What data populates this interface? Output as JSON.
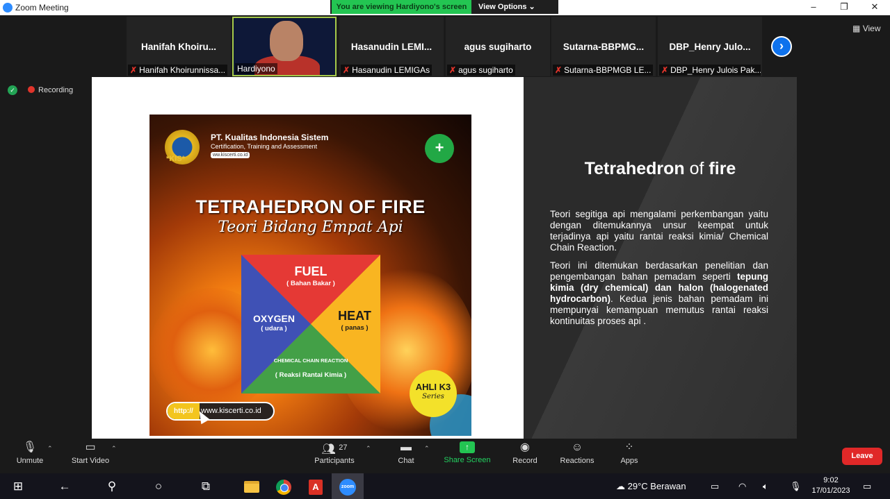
{
  "window": {
    "title": "Zoom Meeting",
    "minimize_icon": "minimize-icon",
    "restore_icon": "restore-icon",
    "close_icon": "close-icon"
  },
  "share_banner": {
    "viewing_text": "You are viewing Hardiyono's screen",
    "view_options_label": "View Options"
  },
  "participants": [
    {
      "tile_name": "Hanifah  Khoiru...",
      "label": "Hanifah Khoirunnissa...",
      "muted": true,
      "video": false
    },
    {
      "tile_name": "",
      "label": "Hardiyono",
      "muted": false,
      "video": true
    },
    {
      "tile_name": "Hasanudin  LEMI...",
      "label": "Hasanudin LEMIGAs",
      "muted": true,
      "video": false
    },
    {
      "tile_name": "agus sugiharto",
      "label": "agus sugiharto",
      "muted": true,
      "video": false
    },
    {
      "tile_name": "Sutarna-BBPMG...",
      "label": "Sutarna-BBPMGB LE...",
      "muted": true,
      "video": false
    },
    {
      "tile_name": "DBP_Henry  Julo...",
      "label": "DBP_Henry Julois Pak...",
      "muted": true,
      "video": false
    }
  ],
  "view_label": "View",
  "recording_label": "Recording",
  "poster": {
    "company": "PT. Kualitas Indonesia Sistem",
    "company_sub": "Certification, Training and Assessment",
    "company_url": "ww.kiscerti.co.id",
    "logo_text": "*KIS*",
    "title": "TETRAHEDRON OF FIRE",
    "subtitle": "Teori Bidang Empat Api",
    "fuel": "FUEL",
    "fuel_sub": "( Bahan Bakar )",
    "heat": "HEAT",
    "heat_sub": "( panas )",
    "oxygen": "OXYGEN",
    "oxygen_sub": "( udara )",
    "chemical": "CHEMICAL CHAIN REACTION",
    "chemical_sub": "( Reaksi Rantai Kimia )",
    "badge": "AHLI K3",
    "badge_sub": "Series",
    "url_prefix": "http://",
    "url": "www.kiscerti.co.id"
  },
  "slide": {
    "title_bold1": "Tetrahedron",
    "title_mid": " of ",
    "title_bold2": "fire",
    "para1": "Teori segitiga api mengalami perkembangan yaitu dengan ditemukannya unsur keempat untuk terjadinya api yaitu rantai reaksi kimia/ Chemical Chain Reaction.",
    "para2_a": "Teori ini ditemukan berdasarkan penelitian dan pengembangan bahan pemadam seperti ",
    "para2_b": "tepung kimia (dry chemical) dan halon (halogenated hydrocarbon)",
    "para2_c": ". Kedua jenis bahan pemadam ini mempunyai kemampuan memutus rantai reaksi kontinuitas proses api ."
  },
  "controls": {
    "unmute": "Unmute",
    "start_video": "Start Video",
    "participants": "Participants",
    "participants_count": "27",
    "chat": "Chat",
    "share_screen": "Share Screen",
    "record": "Record",
    "reactions": "Reactions",
    "apps": "Apps",
    "leave": "Leave"
  },
  "taskbar": {
    "weather": "29°C  Berawan",
    "time": "9:02",
    "date": "17/01/2023"
  }
}
